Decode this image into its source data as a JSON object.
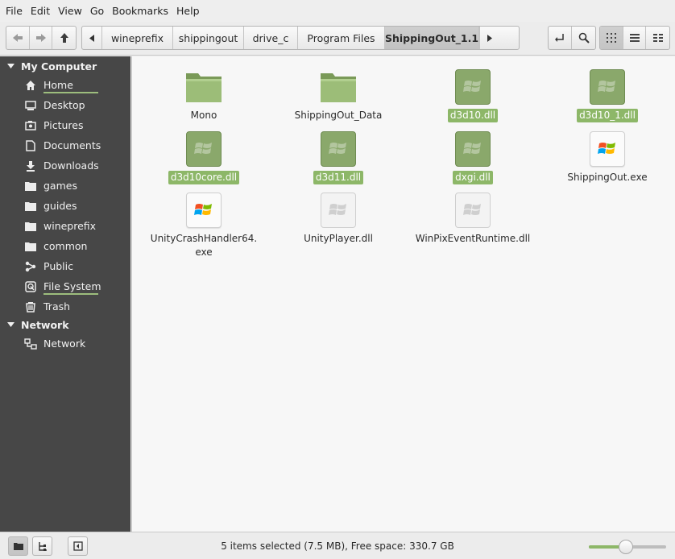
{
  "menu": [
    "File",
    "Edit",
    "View",
    "Go",
    "Bookmarks",
    "Help"
  ],
  "breadcrumbs": [
    "wineprefix",
    "shippingout",
    "drive_c",
    "Program Files",
    "ShippingOut_1.1"
  ],
  "sidebar": {
    "sections": [
      {
        "title": "My Computer",
        "items": [
          {
            "label": "Home",
            "icon": "home-icon"
          },
          {
            "label": "Desktop",
            "icon": "desktop-icon"
          },
          {
            "label": "Pictures",
            "icon": "pictures-icon"
          },
          {
            "label": "Documents",
            "icon": "documents-icon"
          },
          {
            "label": "Downloads",
            "icon": "downloads-icon"
          },
          {
            "label": "games",
            "icon": "folder-icon"
          },
          {
            "label": "guides",
            "icon": "folder-icon"
          },
          {
            "label": "wineprefix",
            "icon": "folder-icon"
          },
          {
            "label": "common",
            "icon": "folder-icon"
          },
          {
            "label": "Public",
            "icon": "share-icon"
          },
          {
            "label": "File System",
            "icon": "harddisk-icon"
          },
          {
            "label": "Trash",
            "icon": "trash-icon"
          }
        ]
      },
      {
        "title": "Network",
        "items": [
          {
            "label": "Network",
            "icon": "network-icon"
          }
        ]
      }
    ]
  },
  "files": [
    {
      "name": "Mono",
      "type": "folder",
      "selected": false
    },
    {
      "name": "ShippingOut_Data",
      "type": "folder",
      "selected": false
    },
    {
      "name": "d3d10.dll",
      "type": "dll",
      "selected": true
    },
    {
      "name": "d3d10_1.dll",
      "type": "dll",
      "selected": true
    },
    {
      "name": "d3d10core.dll",
      "type": "dll",
      "selected": true
    },
    {
      "name": "d3d11.dll",
      "type": "dll",
      "selected": true
    },
    {
      "name": "dxgi.dll",
      "type": "dll",
      "selected": true
    },
    {
      "name": "ShippingOut.exe",
      "type": "exe",
      "selected": false
    },
    {
      "name": "UnityCrashHandler64.\nexe",
      "type": "exe",
      "selected": false
    },
    {
      "name": "UnityPlayer.dll",
      "type": "dll",
      "selected": false
    },
    {
      "name": "WinPixEventRuntime.dll",
      "type": "dll",
      "selected": false
    }
  ],
  "status": {
    "text": "5 items selected (7.5 MB), Free space: 330.7 GB",
    "zoom_level": 0.45
  },
  "colors": {
    "accent": "#8db768",
    "sidebar_bg": "#474747"
  }
}
